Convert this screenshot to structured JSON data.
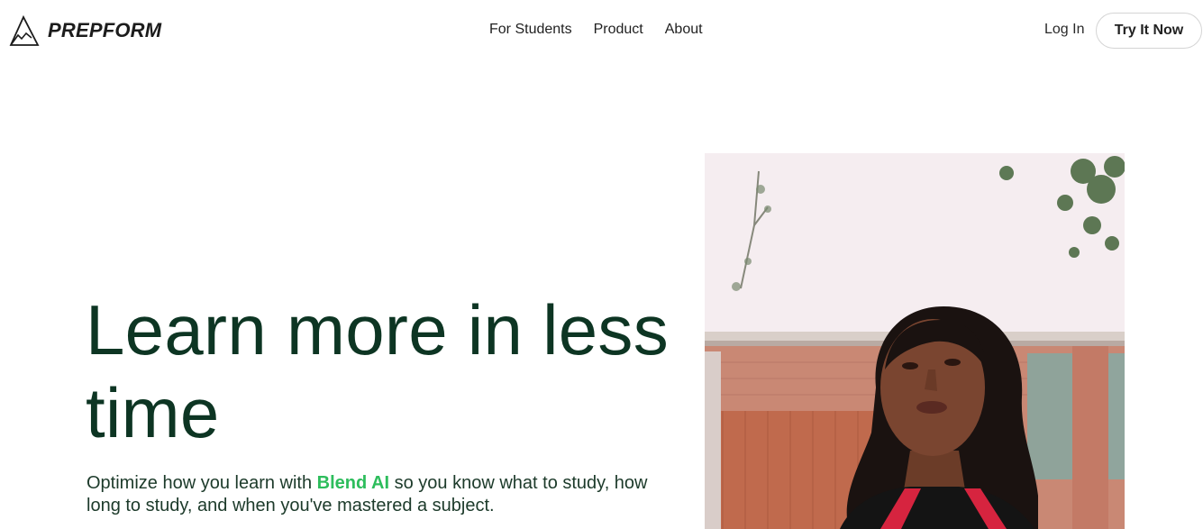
{
  "brand": {
    "name": "PREPFORM",
    "logo_icon": "mountain-triangle-icon"
  },
  "nav": {
    "items": [
      {
        "label": "For Students"
      },
      {
        "label": "Product"
      },
      {
        "label": "About"
      }
    ],
    "login_label": "Log In",
    "cta_label": "Try It Now"
  },
  "hero": {
    "title": "Learn more in less time",
    "subtitle_before": "Optimize how you learn with ",
    "subtitle_highlight": "Blend AI",
    "subtitle_after": " so you know what to study, how long to study, and when you've mastered a subject."
  },
  "colors": {
    "heading": "#0d3523",
    "accent": "#2dbd5c",
    "text": "#1c3a2a"
  }
}
